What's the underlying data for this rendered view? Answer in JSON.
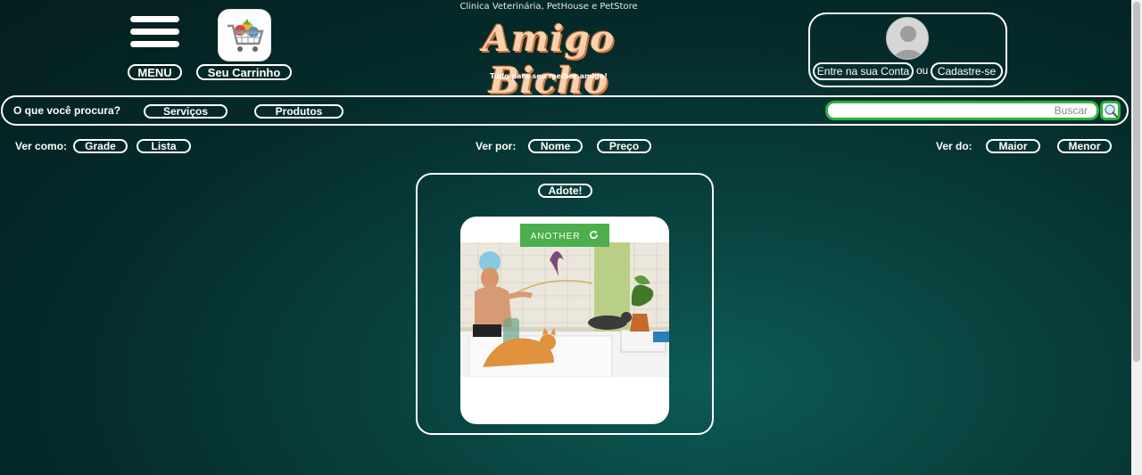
{
  "header": {
    "menu_label": "MENU",
    "cart_label": "Seu Carrinho",
    "tagline_top": "Clinica Veterinária, PetHouse e PetStore",
    "logo": "Amigo Bicho",
    "tagline_bottom": "Tudo para seu melhor amigo!",
    "account": {
      "login_label": "Entre na sua Conta",
      "or_text": "ou",
      "signup_label": "Cadastre-se"
    }
  },
  "search": {
    "prompt": "O que você procura?",
    "services_label": "Serviços",
    "products_label": "Produtos",
    "placeholder": "Buscar"
  },
  "view_options": {
    "view_as_label": "Ver como:",
    "grid_label": "Grade",
    "list_label": "Lista",
    "sort_by_label": "Ver por:",
    "name_label": "Nome",
    "price_label": "Preço",
    "order_label": "Ver do:",
    "bigger_label": "Maior",
    "smaller_label": "Menor"
  },
  "adopt": {
    "title": "Adote!",
    "another_label": "ANOTHER"
  },
  "colors": {
    "accent_green": "#4cae4c",
    "search_border": "#2bb33a",
    "logo_color": "#f6d3b0"
  },
  "icons": {
    "menu": "hamburger-icon",
    "cart": "shopping-cart-icon",
    "avatar": "user-avatar-icon",
    "search": "magnifier-icon",
    "refresh": "refresh-icon"
  }
}
